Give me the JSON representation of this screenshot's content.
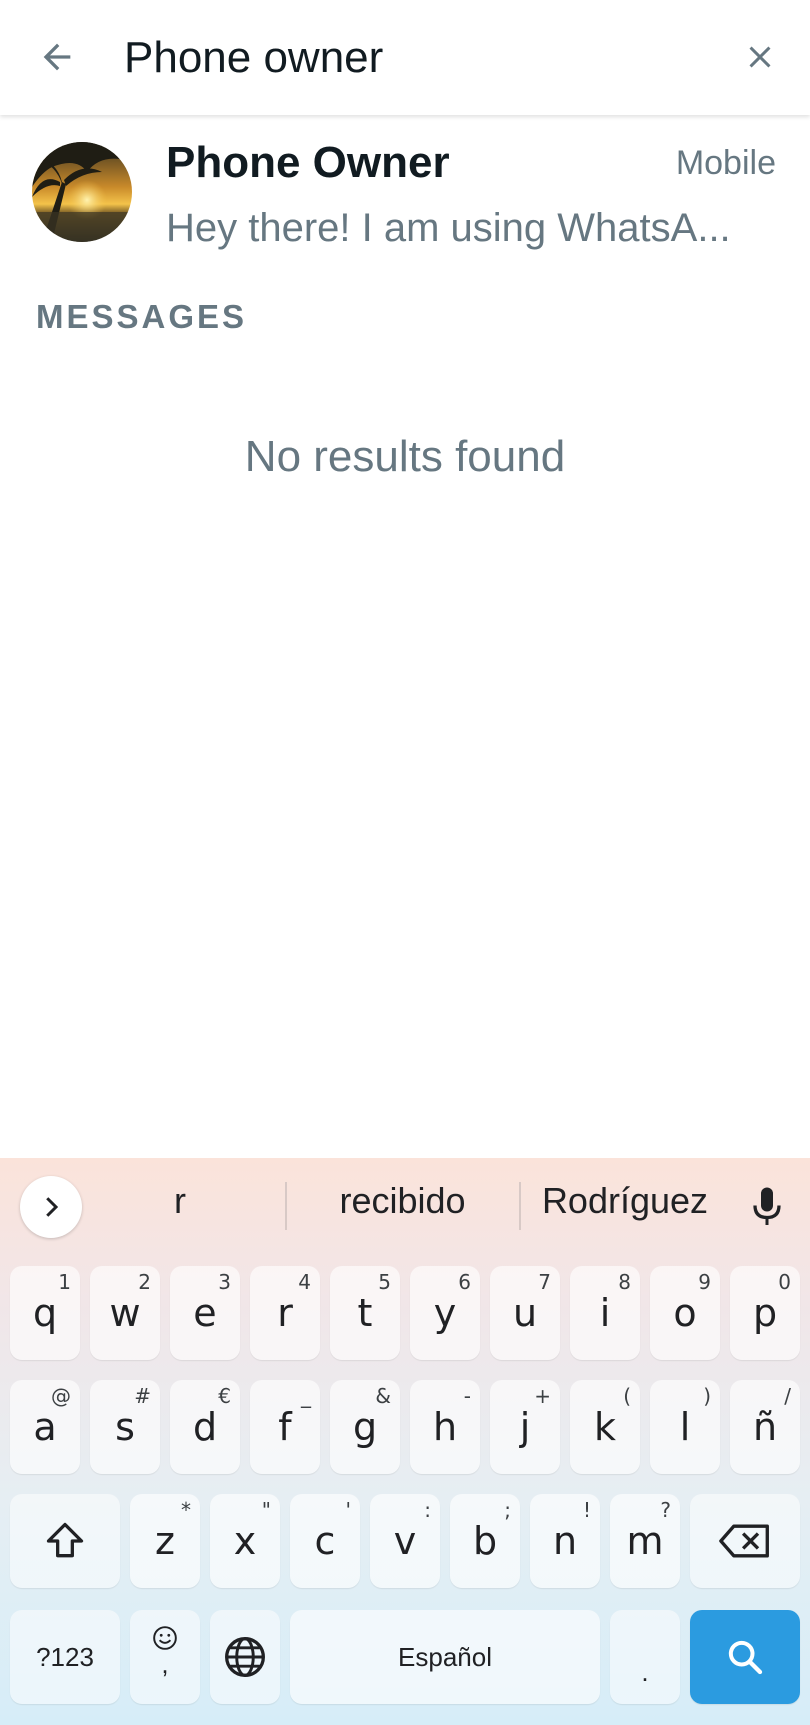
{
  "search": {
    "query": "Phone owner"
  },
  "contact": {
    "name": "Phone Owner",
    "type": "Mobile",
    "status": "Hey there! I am using WhatsA..."
  },
  "messages_header": "MESSAGES",
  "no_results": "No results found",
  "keyboard": {
    "suggestions": [
      "r",
      "recibido",
      "Rodríguez"
    ],
    "row1": [
      {
        "key": "q",
        "hint": "1"
      },
      {
        "key": "w",
        "hint": "2"
      },
      {
        "key": "e",
        "hint": "3"
      },
      {
        "key": "r",
        "hint": "4"
      },
      {
        "key": "t",
        "hint": "5"
      },
      {
        "key": "y",
        "hint": "6"
      },
      {
        "key": "u",
        "hint": "7"
      },
      {
        "key": "i",
        "hint": "8"
      },
      {
        "key": "o",
        "hint": "9"
      },
      {
        "key": "p",
        "hint": "0"
      }
    ],
    "row2": [
      {
        "key": "a",
        "hint": "@"
      },
      {
        "key": "s",
        "hint": "#"
      },
      {
        "key": "d",
        "hint": "€"
      },
      {
        "key": "f",
        "hint": "_"
      },
      {
        "key": "g",
        "hint": "&"
      },
      {
        "key": "h",
        "hint": "-"
      },
      {
        "key": "j",
        "hint": "+"
      },
      {
        "key": "k",
        "hint": "("
      },
      {
        "key": "l",
        "hint": ")"
      },
      {
        "key": "ñ",
        "hint": "/"
      }
    ],
    "row3": [
      {
        "key": "z",
        "hint": "*"
      },
      {
        "key": "x",
        "hint": "\""
      },
      {
        "key": "c",
        "hint": "'"
      },
      {
        "key": "v",
        "hint": ":"
      },
      {
        "key": "b",
        "hint": ";"
      },
      {
        "key": "n",
        "hint": "!"
      },
      {
        "key": "m",
        "hint": "?"
      }
    ],
    "symbols_label": "?123",
    "comma_label": ",",
    "space_label": "Español",
    "period_label": ".",
    "accent_color": "#2b9be0"
  },
  "icons": {
    "back": "arrow-left-icon",
    "clear": "close-icon",
    "expand": "chevron-right-icon",
    "mic": "microphone-icon",
    "shift": "shift-icon",
    "backspace": "backspace-icon",
    "emoji": "emoji-icon",
    "globe": "globe-icon",
    "search": "search-icon"
  }
}
